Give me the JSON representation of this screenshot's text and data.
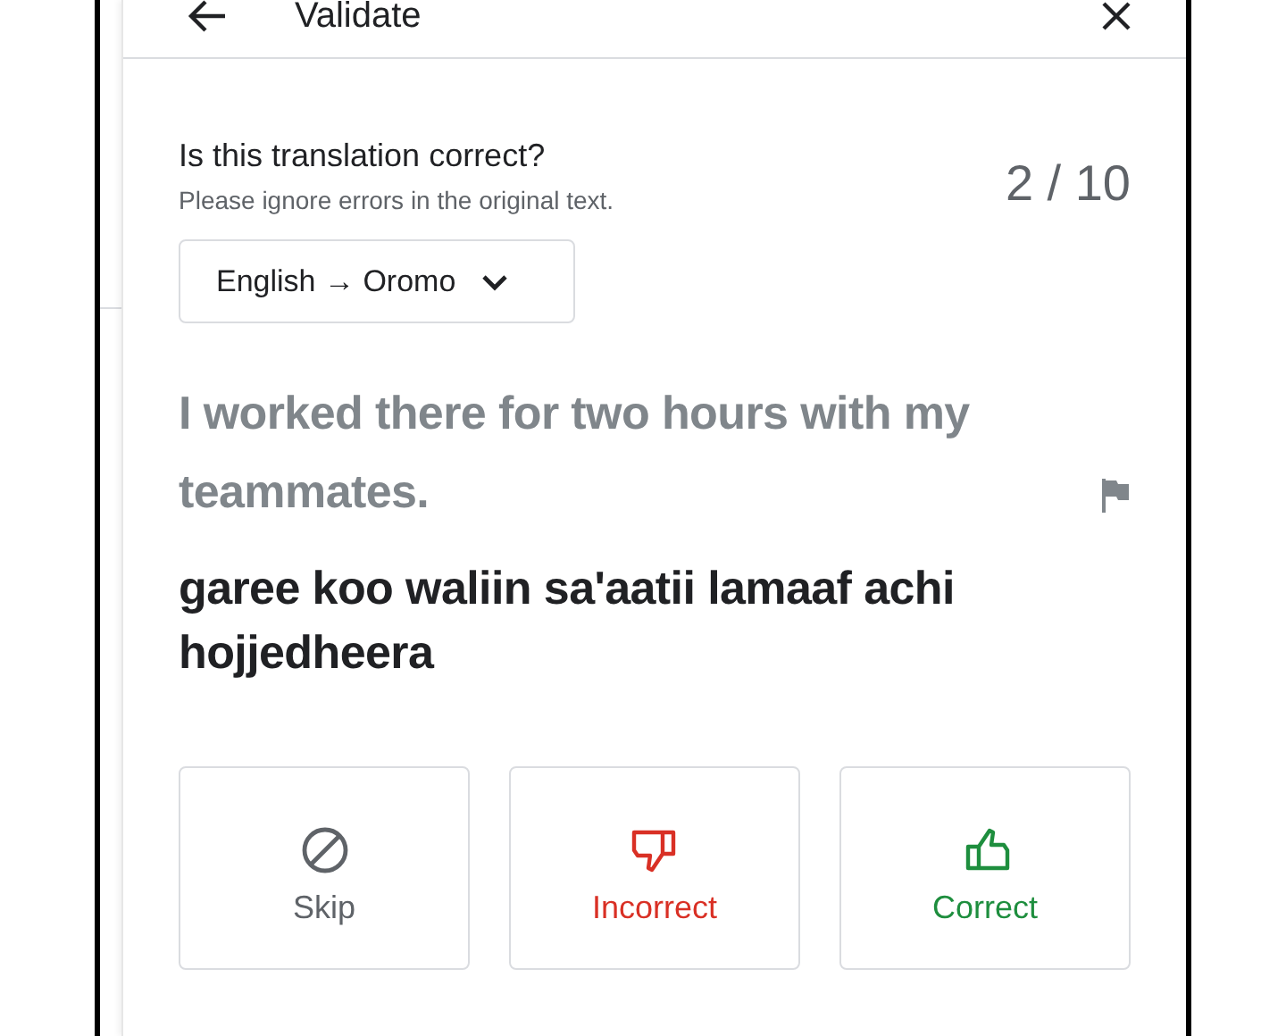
{
  "header": {
    "title": "Validate"
  },
  "question": {
    "title": "Is this translation correct?",
    "subtitle": "Please ignore errors in the original text.",
    "counter": "2 / 10"
  },
  "language_select": {
    "value": "English → Oromo"
  },
  "source_text": "I worked there for two hours with my teammates.",
  "translation": "garee koo waliin sa'aatii lamaaf achi hojjedheera",
  "actions": [
    {
      "kind": "skip",
      "label": "Skip",
      "color": "#5f6368"
    },
    {
      "kind": "incorrect",
      "label": "Incorrect",
      "color": "#d93025"
    },
    {
      "kind": "correct",
      "label": "Correct",
      "color": "#1e8e3e"
    }
  ]
}
